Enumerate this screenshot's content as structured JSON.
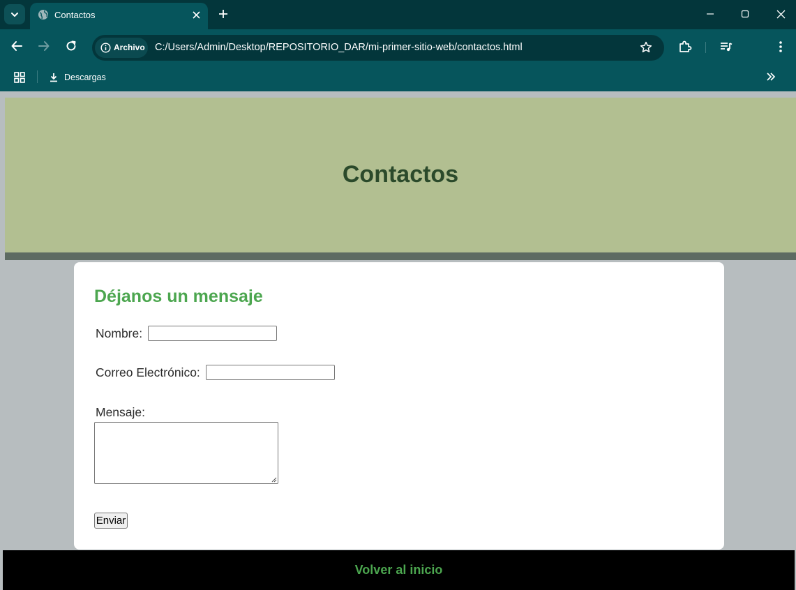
{
  "browser": {
    "tab": {
      "title": "Contactos"
    },
    "address": {
      "chip_label": "Archivo",
      "url": "C:/Users/Admin/Desktop/REPOSITORIO_DAR/mi-primer-sitio-web/contactos.html"
    },
    "bookmarks": [
      {
        "label": "Descargas",
        "icon": "download-icon"
      }
    ],
    "colors": {
      "frame": "#03363b",
      "toolbar": "#06555c",
      "omnibox": "#03363b"
    }
  },
  "page": {
    "header": {
      "title": "Contactos"
    },
    "form": {
      "heading": "Déjanos un mensaje",
      "name_label": "Nombre:",
      "name_value": "",
      "email_label": "Correo Electrónico:",
      "email_value": "",
      "message_label": "Mensaje:",
      "message_value": "",
      "submit_label": "Enviar"
    },
    "footer": {
      "link_label": "Volver al inicio"
    },
    "colors": {
      "background": "#b7bdbf",
      "header": "#b2bf91",
      "header_band": "#5d6b62",
      "title": "#2b4a2b",
      "accent": "#4ca64f",
      "footer": "#000000"
    }
  }
}
